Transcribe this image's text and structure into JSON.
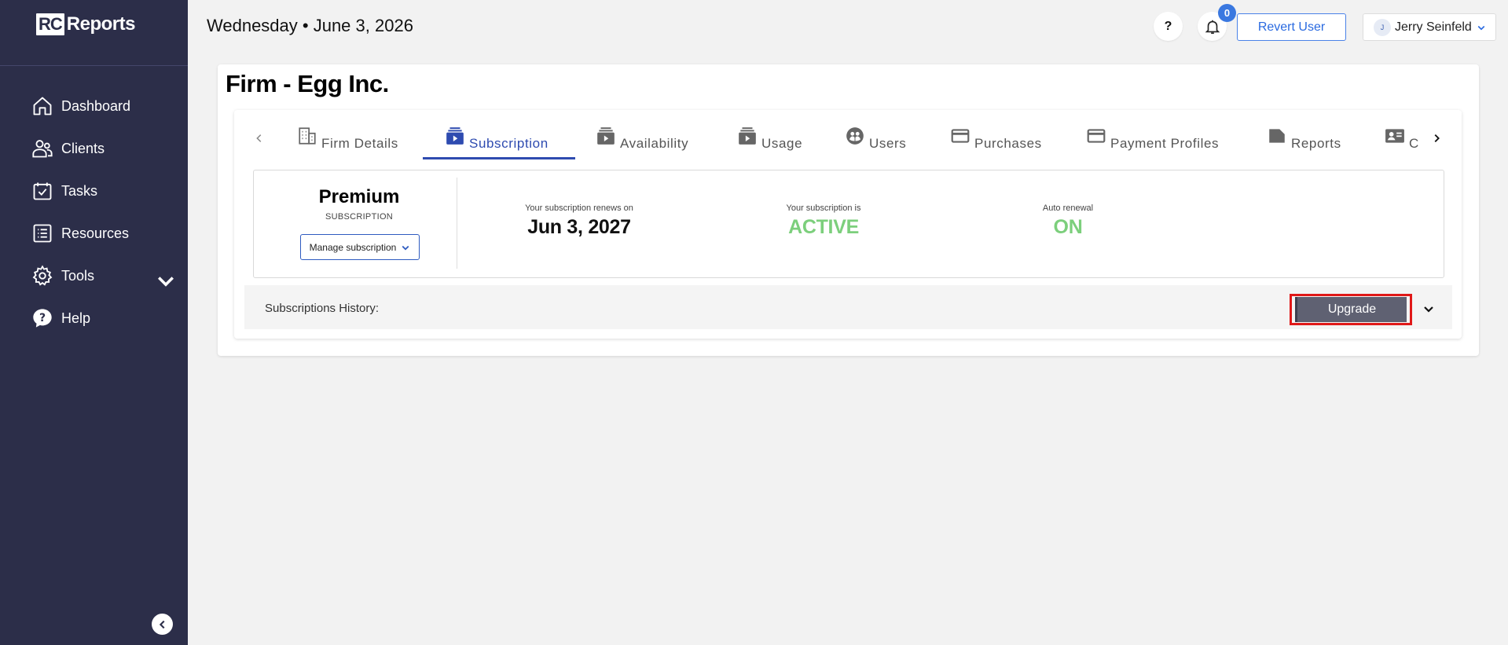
{
  "app": {
    "logo_box": "RC",
    "logo_text": "Reports"
  },
  "sidebar": {
    "items": [
      {
        "label": "Dashboard",
        "icon": "home-icon"
      },
      {
        "label": "Clients",
        "icon": "users-icon"
      },
      {
        "label": "Tasks",
        "icon": "calendar-check-icon"
      },
      {
        "label": "Resources",
        "icon": "list-icon"
      },
      {
        "label": "Tools",
        "icon": "gear-icon"
      },
      {
        "label": "Help",
        "icon": "help-bubble-icon"
      }
    ]
  },
  "header": {
    "date": "Wednesday • June 3, 2026",
    "help_label": "?",
    "notification_count": "0",
    "revert_label": "Revert User",
    "user_initial": "J",
    "user_name": "Jerry Seinfeld"
  },
  "page": {
    "title": "Firm - Egg Inc."
  },
  "tabs": [
    {
      "label": "Firm Details",
      "icon": "building-icon"
    },
    {
      "label": "Subscription",
      "icon": "subscription-icon",
      "active": true
    },
    {
      "label": "Availability",
      "icon": "subscription-icon"
    },
    {
      "label": "Usage",
      "icon": "subscription-icon"
    },
    {
      "label": "Users",
      "icon": "group-icon"
    },
    {
      "label": "Purchases",
      "icon": "credit-card-icon"
    },
    {
      "label": "Payment Profiles",
      "icon": "credit-card-icon"
    },
    {
      "label": "Reports",
      "icon": "folder-icon"
    },
    {
      "label": "C",
      "icon": "contact-card-icon"
    }
  ],
  "subscription": {
    "plan": "Premium",
    "plan_caption": "SUBSCRIPTION",
    "manage_label": "Manage subscription",
    "renews_label": "Your subscription renews on",
    "renews_value": "Jun 3, 2027",
    "status_label": "Your subscription is",
    "status_value": "ACTIVE",
    "auto_label": "Auto renewal",
    "auto_value": "ON"
  },
  "history": {
    "label": "Subscriptions History:",
    "upgrade_label": "Upgrade"
  },
  "colors": {
    "sidebar": "#2c2e49",
    "accent": "#2e4bb0",
    "status_green": "#7ccf7c",
    "upgrade_bg": "#5f6172",
    "highlight": "#e01818"
  }
}
